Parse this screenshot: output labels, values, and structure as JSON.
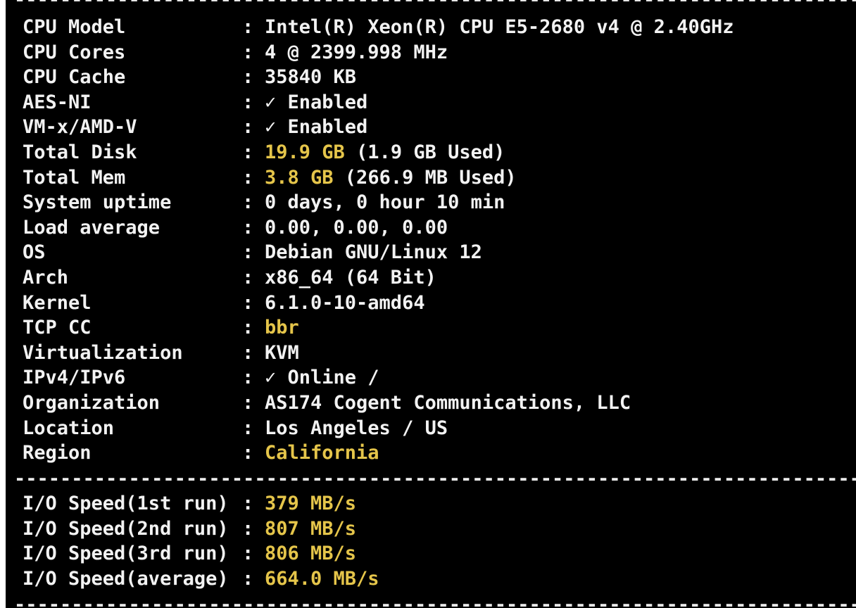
{
  "separator": "--------------------------------------------------------------------------------------",
  "rows": [
    {
      "label": "CPU Model",
      "value": "Intel(R) Xeon(R) CPU E5-2680 v4 @ 2.40GHz"
    },
    {
      "label": "CPU Cores",
      "value": "4 @ 2399.998 MHz"
    },
    {
      "label": "CPU Cache",
      "value": "35840 KB"
    },
    {
      "label": "AES-NI",
      "value": "✓ Enabled"
    },
    {
      "label": "VM-x/AMD-V",
      "value": "✓ Enabled"
    },
    {
      "label": "Total Disk",
      "value_highlight": "19.9 GB",
      "value_rest": " (1.9 GB Used)"
    },
    {
      "label": "Total Mem",
      "value_highlight": "3.8 GB",
      "value_rest": " (266.9 MB Used)"
    },
    {
      "label": "System uptime",
      "value": "0 days, 0 hour 10 min"
    },
    {
      "label": "Load average",
      "value": "0.00, 0.00, 0.00"
    },
    {
      "label": "OS",
      "value": "Debian GNU/Linux 12"
    },
    {
      "label": "Arch",
      "value": "x86_64 (64 Bit)"
    },
    {
      "label": "Kernel",
      "value": "6.1.0-10-amd64"
    },
    {
      "label": "TCP CC",
      "value_highlight": "bbr"
    },
    {
      "label": "Virtualization",
      "value": "KVM"
    },
    {
      "label": "IPv4/IPv6",
      "value": "✓ Online /"
    },
    {
      "label": "Organization",
      "value": "AS174 Cogent Communications, LLC"
    },
    {
      "label": "Location",
      "value": "Los Angeles / US"
    },
    {
      "label": "Region",
      "value_highlight": "California"
    }
  ],
  "io_rows": [
    {
      "label": "I/O Speed(1st run)",
      "value_highlight": "379 MB/s"
    },
    {
      "label": "I/O Speed(2nd run)",
      "value_highlight": "807 MB/s"
    },
    {
      "label": "I/O Speed(3rd run)",
      "value_highlight": "806 MB/s"
    },
    {
      "label": "I/O Speed(average)",
      "value_highlight": "664.0 MB/s"
    }
  ],
  "colors": {
    "background": "#000000",
    "text": "#f2f2f2",
    "highlight": "#e5c54a"
  }
}
